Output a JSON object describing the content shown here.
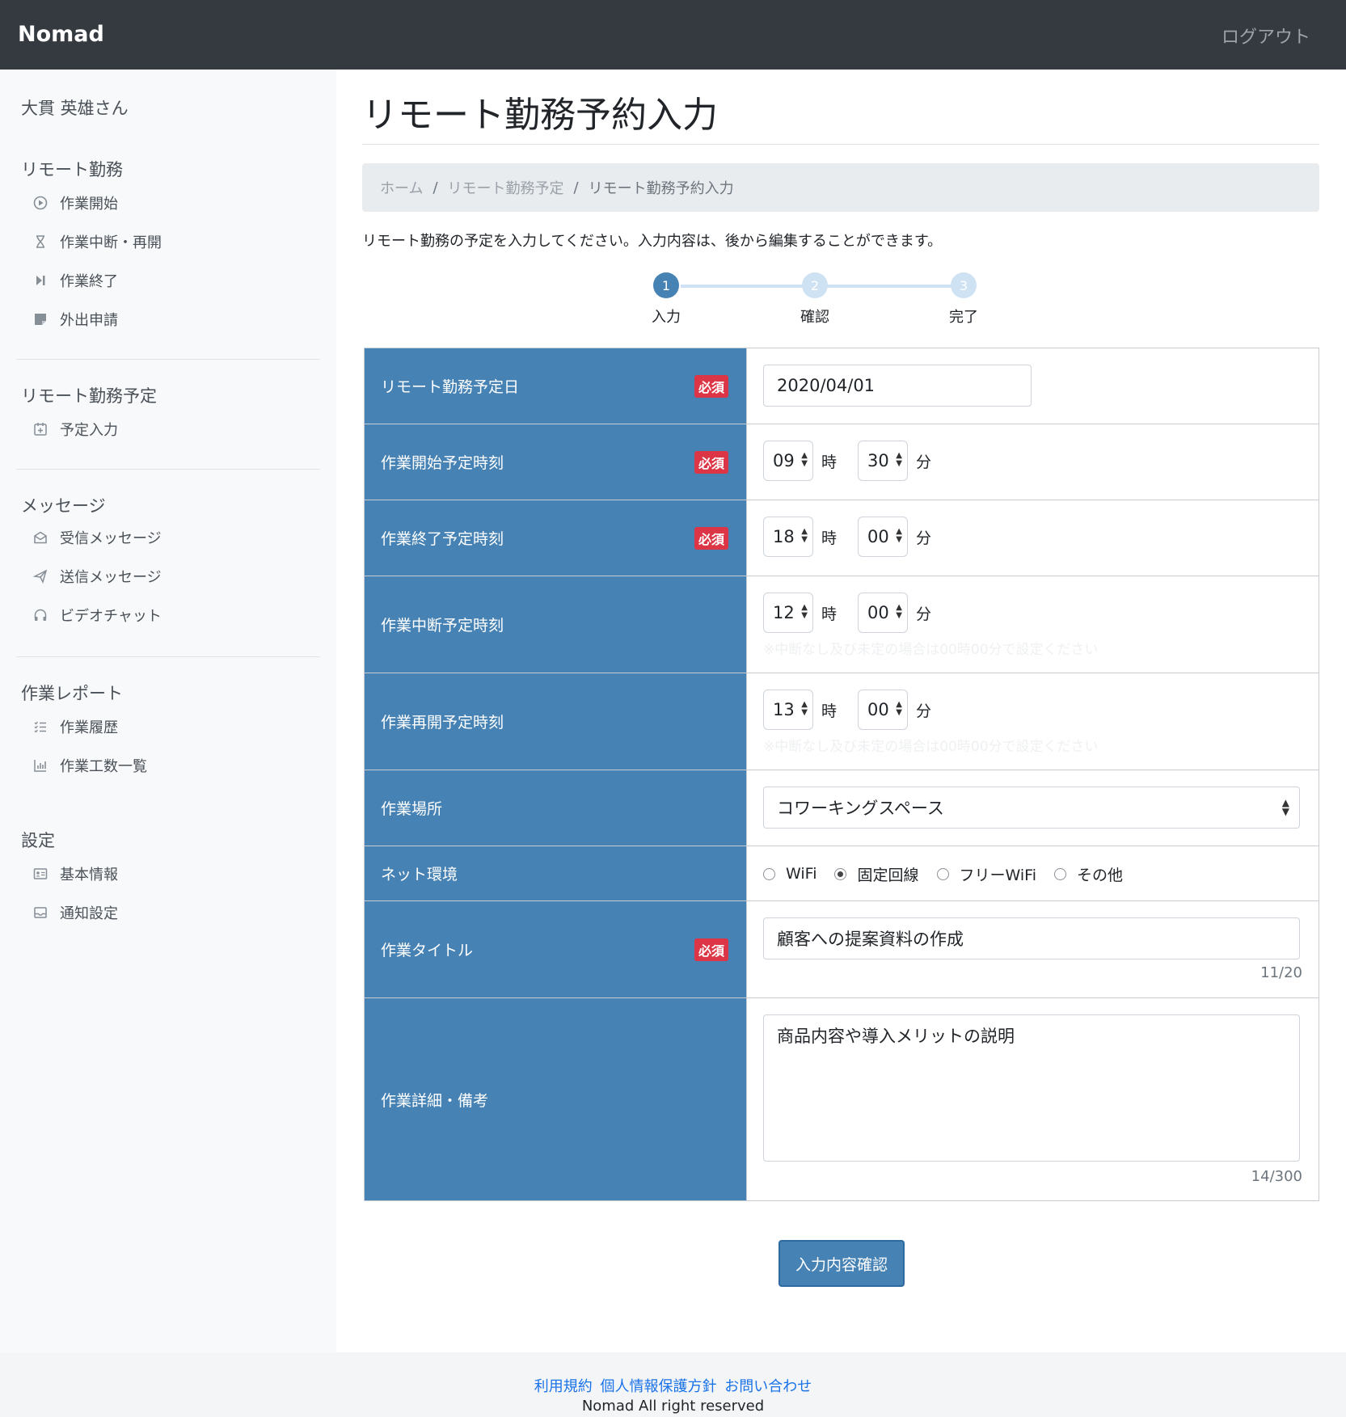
{
  "header": {
    "brand": "Nomad",
    "logout": "ログアウト"
  },
  "sidebar": {
    "user": "大貫 英雄さん",
    "sections": [
      {
        "title": "リモート勤務",
        "items": [
          "作業開始",
          "作業中断・再開",
          "作業終了",
          "外出申請"
        ]
      },
      {
        "title": "リモート勤務予定",
        "items": [
          "予定入力"
        ]
      },
      {
        "title": "メッセージ",
        "items": [
          "受信メッセージ",
          "送信メッセージ",
          "ビデオチャット"
        ]
      },
      {
        "title": "作業レポート",
        "items": [
          "作業履歴",
          "作業工数一覧"
        ]
      },
      {
        "title": "設定",
        "items": [
          "基本情報",
          "通知設定"
        ]
      }
    ]
  },
  "page": {
    "title": "リモート勤務予約入力",
    "breadcrumb": [
      "ホーム",
      "リモート勤務予定",
      "リモート勤務予約入力"
    ],
    "intro": "リモート勤務の予定を入力してください。入力内容は、後から編集することができます。"
  },
  "stepper": [
    {
      "num": "1",
      "label": "入力",
      "active": true
    },
    {
      "num": "2",
      "label": "確認",
      "active": false
    },
    {
      "num": "3",
      "label": "完了",
      "active": false
    }
  ],
  "form": {
    "required_label": "必須",
    "hour_unit": "時",
    "minute_unit": "分",
    "date": {
      "label": "リモート勤務予定日",
      "value": "2020/04/01"
    },
    "start": {
      "label": "作業開始予定時刻",
      "hour": "09",
      "minute": "30"
    },
    "end": {
      "label": "作業終了予定時刻",
      "hour": "18",
      "minute": "00"
    },
    "break": {
      "label": "作業中断予定時刻",
      "hour": "12",
      "minute": "00",
      "hint": "※中断なし及び未定の場合は00時00分で設定ください"
    },
    "resume": {
      "label": "作業再開予定時刻",
      "hour": "13",
      "minute": "00",
      "hint": "※中断なし及び未定の場合は00時00分で設定ください"
    },
    "place": {
      "label": "作業場所",
      "value": "コワーキングスペース"
    },
    "network": {
      "label": "ネット環境",
      "options": [
        "WiFi",
        "固定回線",
        "フリーWiFi",
        "その他"
      ],
      "selected": "固定回線"
    },
    "work_title": {
      "label": "作業タイトル",
      "value": "顧客への提案資料の作成",
      "counter": "11/20"
    },
    "detail": {
      "label": "作業詳細・備考",
      "value": "商品内容や導入メリットの説明",
      "counter": "14/300"
    }
  },
  "submit_label": "入力内容確認",
  "footer": {
    "links": [
      "利用規約",
      "個人情報保護方針",
      "お問い合わせ"
    ],
    "copyright": "Nomad All right reserved"
  },
  "colors": {
    "header_bg": "#343a40",
    "accent": "#4682b4",
    "required": "#dc3545",
    "link": "#1a73e8"
  }
}
